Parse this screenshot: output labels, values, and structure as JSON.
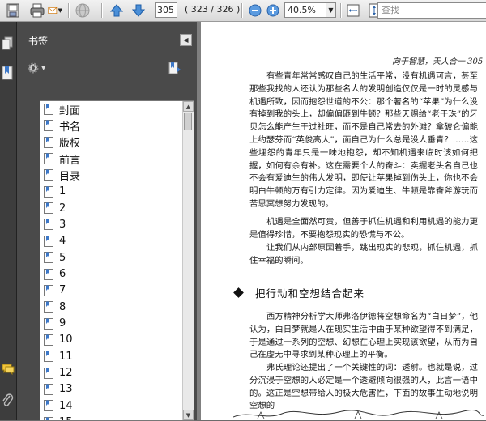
{
  "toolbar": {
    "current_page": "305",
    "page_count": "( 323 / 326 )",
    "zoom": "40.5%",
    "search_placeholder": "查找"
  },
  "bookmarks_panel": {
    "title": "书签",
    "items": [
      "封面",
      "书名",
      "版权",
      "前言",
      "目录",
      "1",
      "2",
      "3",
      "4",
      "5",
      "6",
      "7",
      "8",
      "9",
      "10",
      "11",
      "12",
      "13",
      "14",
      "15"
    ]
  },
  "document": {
    "running_head": "向于智慧，天人合一  305",
    "paragraphs": [
      "有些青年常常感叹自己的生活平常，没有机遇可言，甚至那些我找的人还认为那些名人的发明创造仅仅是一时的灵感与机遇所致，因而抱怨世道的不公：那个著名的“苹果”为什么没有掉到我的头上，却偏偏砸到牛顿？那些天赐给“老于珠”的牙贝怎么能产生于过社旺，而不是自己常去的外滩？拿破仑偏能上约瑟芬而“英俊高大”，面自己为什么总是没人垂青？……这些埋怨的青年只是一味地抱怨，却不知机遇来临时该如何把握，如何有余有补。这在需要个人的奋斗：卖掘老头名自己也不会有爱迪生的伟大发明，即使让苹果掉到伤头上，你也不会明白牛顿的万有引力定律。因为爱迪生、牛顿是靠奋斧游玩而苦思冥想努力发现的。",
      "机遇是全面然可贵，但善于抓住机遇和利用机遇的能力更是值得珍惜，不要抱怨现实的恐慌与不公。",
      "让我们从内部原因着手，跳出现实的悲观，抓住机遇，抓住幸福的瞬间。"
    ],
    "section_title": "把行动和空想结合起来",
    "section_paragraphs": [
      "西方精神分析学大师弗洛伊德将空想命名为“白日梦”，他认为，白日梦就是人在现实生活中由于某种欲望得不到满足，于是通过一系列的空想、幻想在心理上实现该欲望，从而为自己在虚无中寻求到某种心理上的平衡。",
      "弗氏理论还提出了一个关键性的词：透射。也就是说，过分沉浸于空想的人必定是一个透避倾向很强的人，此言一语中的。这正是空想带给人的极大危害性，下面的故事生动地说明空想的"
    ]
  }
}
